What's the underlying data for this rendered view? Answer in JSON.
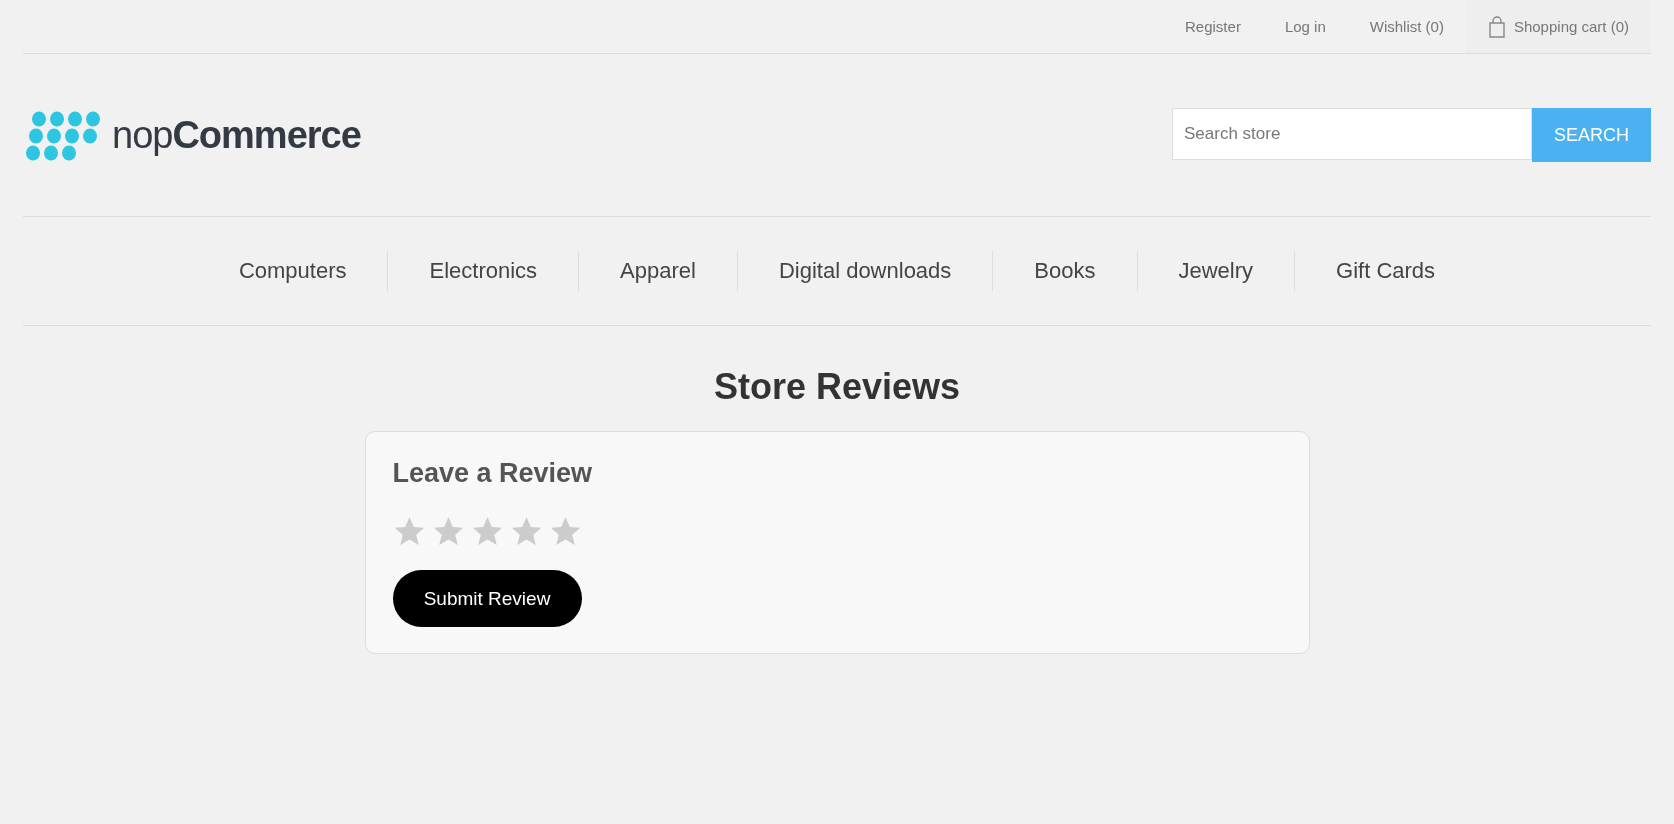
{
  "header_links": [
    {
      "label": "Register"
    },
    {
      "label": "Log in"
    },
    {
      "label": "Wishlist (0)"
    },
    {
      "label": "Shopping cart (0)",
      "kind": "cart"
    }
  ],
  "logo": {
    "text": "nop**Commerce**"
  },
  "search": {
    "placeholder": "Search store",
    "button": "SEARCH"
  },
  "menu": [
    {
      "label": "Computers"
    },
    {
      "label": "Electronics"
    },
    {
      "label": "Apparel"
    },
    {
      "label": "Digital downloads"
    },
    {
      "label": "Books"
    },
    {
      "label": "Jewelry"
    },
    {
      "label": "Gift Cards"
    }
  ],
  "page_title": "Store Reviews",
  "review_form": {
    "title": "Leave a Review",
    "stars": 0,
    "submit": "Submit Review"
  }
}
